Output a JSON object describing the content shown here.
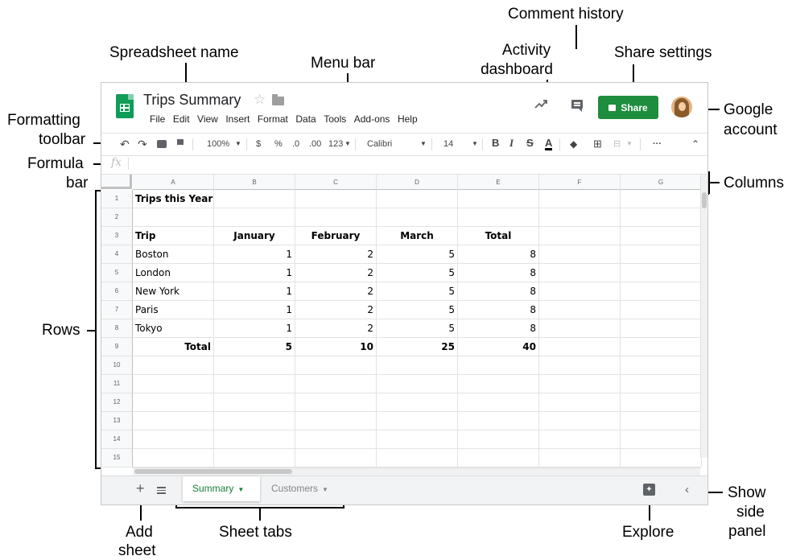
{
  "annotations": {
    "comment_history": "Comment history",
    "spreadsheet_name": "Spreadsheet name",
    "activity_line1": "Activity",
    "activity_line2": "dashboard",
    "share_settings": "Share settings",
    "menu_bar": "Menu bar",
    "google_line1": "Google",
    "google_line2": "account",
    "formatting_line1": "Formatting",
    "formatting_line2": "toolbar",
    "formula_line1": "Formula",
    "formula_line2": "bar",
    "columns": "Columns",
    "rows": "Rows",
    "add_line1": "Add",
    "add_line2": "sheet",
    "sheet_tabs": "Sheet tabs",
    "explore": "Explore",
    "show_line1": "Show",
    "show_line2": "side",
    "show_line3": "panel"
  },
  "header": {
    "title": "Trips Summary",
    "share_label": "Share",
    "menu": [
      "File",
      "Edit",
      "View",
      "Insert",
      "Format",
      "Data",
      "Tools",
      "Add-ons",
      "Help"
    ]
  },
  "toolbar": {
    "zoom": "100%",
    "currency": "$",
    "percent": "%",
    "dec_decrease": ".0",
    "dec_increase": ".00",
    "more_formats": "123",
    "font": "Calibri",
    "font_size": "14",
    "bold": "B",
    "italic": "I",
    "strike": "S",
    "text_color": "A",
    "more": "···"
  },
  "formula_bar": {
    "fx": "fx"
  },
  "columns": [
    "A",
    "B",
    "C",
    "D",
    "E",
    "F",
    "G"
  ],
  "rows": [
    "1",
    "2",
    "3",
    "4",
    "5",
    "6",
    "7",
    "8",
    "9",
    "10",
    "11",
    "12",
    "13",
    "14",
    "15"
  ],
  "cells": {
    "r1": [
      "Trips this Year",
      "",
      "",
      "",
      "",
      "",
      ""
    ],
    "r2": [
      "",
      "",
      "",
      "",
      "",
      "",
      ""
    ],
    "r3": [
      "Trip",
      "January",
      "February",
      "March",
      "Total",
      "",
      ""
    ],
    "r4": [
      "Boston",
      "1",
      "2",
      "5",
      "8",
      "",
      ""
    ],
    "r5": [
      "London",
      "1",
      "2",
      "5",
      "8",
      "",
      ""
    ],
    "r6": [
      "New York",
      "1",
      "2",
      "5",
      "8",
      "",
      ""
    ],
    "r7": [
      "Paris",
      "1",
      "2",
      "5",
      "8",
      "",
      ""
    ],
    "r8": [
      "Tokyo",
      "1",
      "2",
      "5",
      "8",
      "",
      ""
    ],
    "r9": [
      "Total",
      "5",
      "10",
      "25",
      "40",
      "",
      ""
    ]
  },
  "sheet_tabs": [
    {
      "label": "Summary",
      "active": true
    },
    {
      "label": "Customers",
      "active": false
    }
  ],
  "bottom": {
    "add": "+"
  },
  "colors": {
    "share": "#1e8e3e",
    "sheets_logo": "#0f9d58",
    "active_tab": "#188038"
  }
}
